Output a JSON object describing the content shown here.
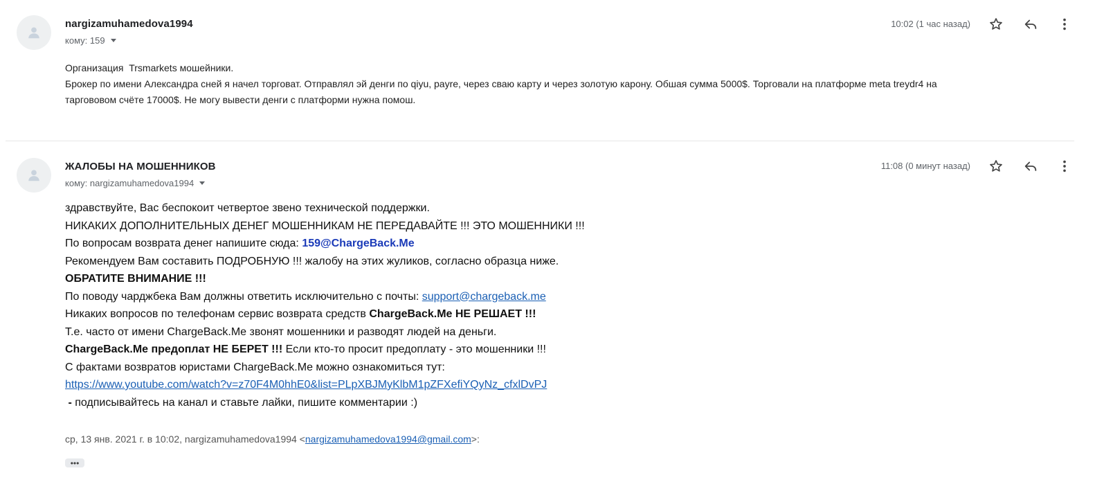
{
  "messages": [
    {
      "sender": "nargizamuhamedova1994",
      "to": "кому: 159",
      "time": "10:02 (1 час назад)",
      "body": [
        "Организация  Trsmarkets мошейники.",
        "Брокер по имени Александра сней я начел торговат. Отправлял эй денги по qiyu, payre, через сваю карту и через золотую карону. Обшая сумма 5000$. Торговали на платформе meta treydr4 на",
        "таргововом счёте 17000$. Не могу вывести денги с платформи нужна помош."
      ]
    },
    {
      "sender": "ЖАЛОБЫ НА МОШЕННИКОВ",
      "to": "кому: nargizamuhamedova1994",
      "time": "11:08 (0 минут назад)",
      "lines": {
        "l1": "здравствуйте, Вас беспокоит четвертое звено технической поддержки.",
        "l2": "НИКАКИХ ДОПОЛНИТЕЛЬНЫХ ДЕНЕГ МОШЕННИКАМ НЕ ПЕРЕДАВАЙТЕ !!! ЭТО МОШЕННИКИ !!!",
        "l3_text": "По вопросам возврата денег напишите сюда: ",
        "l3_email": "159@ChargeBack.Me",
        "l4": "Рекомендуем Вам составить ПОДРОБНУЮ !!! жалобу на этих жуликов, согласно образца ниже.",
        "l5": "ОБРАТИТЕ ВНИМАНИЕ !!!",
        "l6_text": "По поводу чарджбека Вам должны ответить исключительно с почты: ",
        "l6_link": "support@chargeback.me",
        "l7_text": "Никаких вопросов по телефонам сервис возврата средств ",
        "l7_bold": "ChargeBack.Me НЕ РЕШАЕТ !!!",
        "l8": "Т.е. часто от имени ChargeBack.Me звонят мошенники и разводят людей на деньги.",
        "l9_bold": "ChargeBack.Me предоплат НЕ БЕРЕТ !!!",
        "l9_text": " Если кто-то просит предоплату - это мошенники !!!",
        "l10": "С фактами возвратов юристами ChargeBack.Me можно ознакомиться тут:",
        "l11_link": "https://www.youtube.com/watch?v=z70F4M0hhE0&list=PLpXBJMyKlbM1pZFXefiYQyNz_cfxlDvPJ",
        "l12_bold": " - ",
        "l12_text": "подписывайтесь на канал и ставьте лайки, пишите комментарии :)"
      },
      "quote": {
        "prefix": "ср, 13 янв. 2021 г. в 10:02, nargizamuhamedova1994 <",
        "email": "nargizamuhamedova1994@gmail.com",
        "suffix": ">:"
      },
      "expand_label": "•••"
    }
  ],
  "icons": {
    "avatar": "person-icon",
    "star": "star-icon",
    "reply": "reply-icon",
    "more": "more-vert-icon",
    "caret": "caret-down-icon"
  },
  "colors": {
    "sender_text": "#202124",
    "meta_text": "#5f6368",
    "link": "#1a5fb4",
    "email_bold": "#1a3ab8",
    "avatar_bg": "#eef0f1"
  }
}
